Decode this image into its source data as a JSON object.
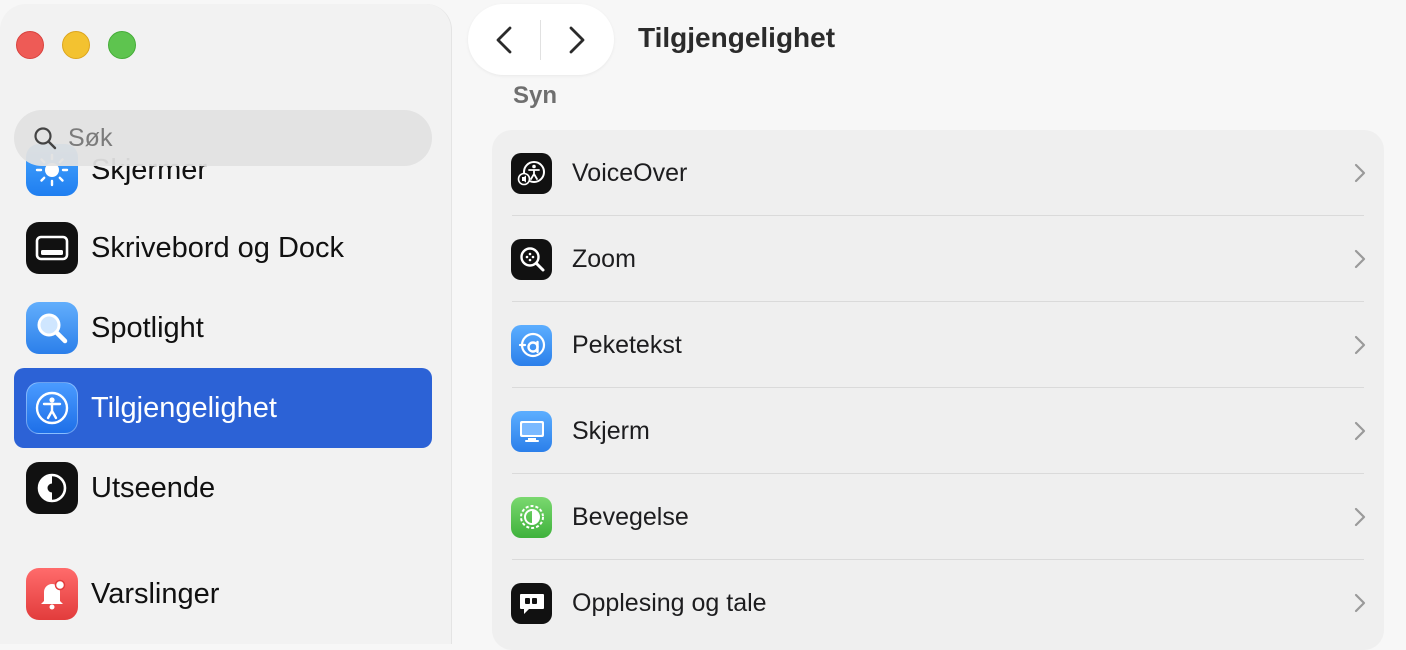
{
  "window": {
    "title": "Tilgjengelighet",
    "controls": [
      "close",
      "minimize",
      "zoom"
    ]
  },
  "toolbar": {
    "back_icon": "chevron-left-icon",
    "forward_icon": "chevron-right-icon"
  },
  "sidebar": {
    "search": {
      "placeholder": "Søk",
      "icon": "search-icon"
    },
    "items": [
      {
        "label": "Skjermer",
        "icon": "sun-icon",
        "color": "#2f8ef3",
        "selected": false
      },
      {
        "label": "Skrivebord og Dock",
        "icon": "dock-icon",
        "color": "#111111",
        "selected": false
      },
      {
        "label": "Spotlight",
        "icon": "magnifier-icon",
        "color": "#3a8ff0",
        "selected": false
      },
      {
        "label": "Tilgjengelighet",
        "icon": "accessibility-icon",
        "color": "#2c62d6",
        "selected": true
      },
      {
        "label": "Utseende",
        "icon": "appearance-icon",
        "color": "#111111",
        "selected": false
      },
      {
        "label": "Varslinger",
        "icon": "bell-icon",
        "color": "#ec4a4a",
        "selected": false
      }
    ]
  },
  "main": {
    "section": "Syn",
    "rows": [
      {
        "label": "VoiceOver",
        "icon": "voiceover-icon",
        "color": "#111111"
      },
      {
        "label": "Zoom",
        "icon": "zoom-icon",
        "color": "#111111"
      },
      {
        "label": "Peketekst",
        "icon": "hover-text-icon",
        "color": "#3a8ff0"
      },
      {
        "label": "Skjerm",
        "icon": "display-icon",
        "color": "#3a8ff0"
      },
      {
        "label": "Bevegelse",
        "icon": "motion-icon",
        "color": "#5cc45a"
      },
      {
        "label": "Opplesing og tale",
        "icon": "speech-icon",
        "color": "#111111"
      }
    ]
  },
  "colors": {
    "selection": "#2c62d6",
    "sidebar_bg": "#f2f2f2",
    "group_bg": "#efefef"
  }
}
